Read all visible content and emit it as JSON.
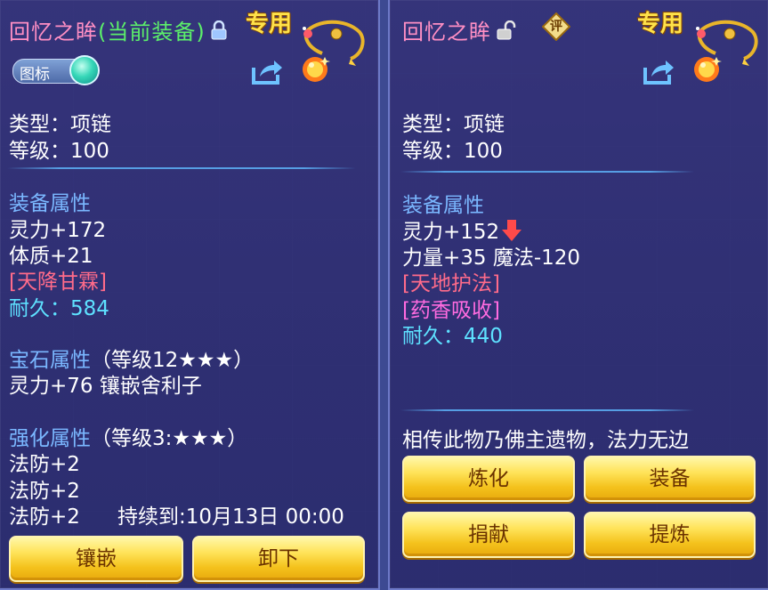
{
  "left_panel": {
    "item_name": "回忆之眸",
    "equipped_tag": "(当前装备)",
    "exclusive_label": "专用",
    "toggle_label": "图标",
    "type_line": "类型：项链",
    "level_line": "等级：100",
    "equip_attr_title": "装备属性",
    "attrs": [
      "灵力+172",
      "体质+21"
    ],
    "special_effect": "[天降甘霖]",
    "durability_label": "耐久：",
    "durability_value": "584",
    "gem_attr_title": "宝石属性",
    "gem_attr_level": "（等级12★★★）",
    "gem_attr_value": "灵力+76 镶嵌舍利子",
    "enhance_title": "强化属性",
    "enhance_level": "（等级3:★★★）",
    "enhance_lines": [
      "法防+2",
      "法防+2",
      "法防+2"
    ],
    "enhance_duration": "持续到:10月13日 00:00",
    "buttons": {
      "inlay": "镶嵌",
      "unequip": "卸下"
    }
  },
  "right_panel": {
    "item_name": "回忆之眸",
    "rate_badge": "评",
    "exclusive_label": "专用",
    "type_line": "类型：项链",
    "level_line": "等级：100",
    "equip_attr_title": "装备属性",
    "attr_line_1": "灵力+152",
    "attr_line_2": "力量+35 魔法-120",
    "special_effect_1": "[天地护法]",
    "special_effect_2": "[药香吸收]",
    "durability_label": "耐久：",
    "durability_value": "440",
    "description": "相传此物乃佛主遗物，法力无边",
    "buttons": {
      "refine": "炼化",
      "equip": "装备",
      "donate": "捐献",
      "extract": "提炼"
    }
  },
  "colors": {
    "title_pink": "#ff8fc4",
    "equipped_green": "#5cf06a",
    "exclusive_gold": "#ffe24a",
    "section_blue": "#7ab7ff",
    "durability_cyan": "#5ee1ff",
    "effect_red": "#ff6b8a",
    "effect_magenta": "#ff6be0",
    "button_gold": "#f4c21c"
  },
  "icons": [
    "lock-closed-icon",
    "lock-open-icon",
    "share-icon",
    "necklace-icon",
    "gem-icon",
    "down-arrow-icon",
    "rate-badge-icon"
  ]
}
